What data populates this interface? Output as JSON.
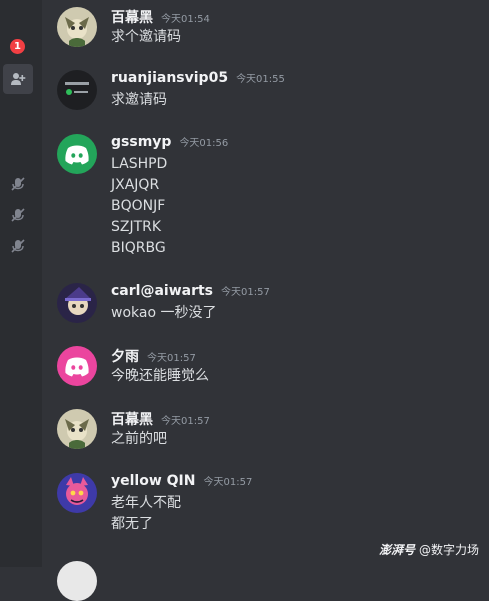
{
  "rail": {
    "badge": "1"
  },
  "messages": [
    {
      "author": "百幕黑",
      "time": "今天01:54",
      "lines": [
        "求个邀请码"
      ]
    },
    {
      "author": "ruanjiansvip05",
      "time": "今天01:55",
      "lines": [
        "求邀请码"
      ]
    },
    {
      "author": "gssmyp",
      "time": "今天01:56",
      "lines": [
        "LASHPD",
        "JXAJQR",
        "BQONJF",
        "SZJTRK",
        "BIQRBG"
      ]
    },
    {
      "author": "carl@aiwarts",
      "time": "今天01:57",
      "lines": [
        "wokao 一秒没了"
      ]
    },
    {
      "author": "夕雨",
      "time": "今天01:57",
      "lines": [
        "今晚还能睡觉么"
      ]
    },
    {
      "author": "百幕黑",
      "time": "今天01:57",
      "lines": [
        "之前的吧"
      ]
    },
    {
      "author": "yellow QIN",
      "time": "今天01:57",
      "lines": [
        "老年人不配",
        "都无了"
      ]
    },
    {
      "author": "",
      "time": "",
      "lines": []
    }
  ],
  "watermark": {
    "logo": "澎湃号",
    "channel": "@数字力场"
  },
  "colors": {
    "discord_green": "#23a55a",
    "discord_pink": "#eb459e",
    "badge_red": "#f23f43"
  }
}
